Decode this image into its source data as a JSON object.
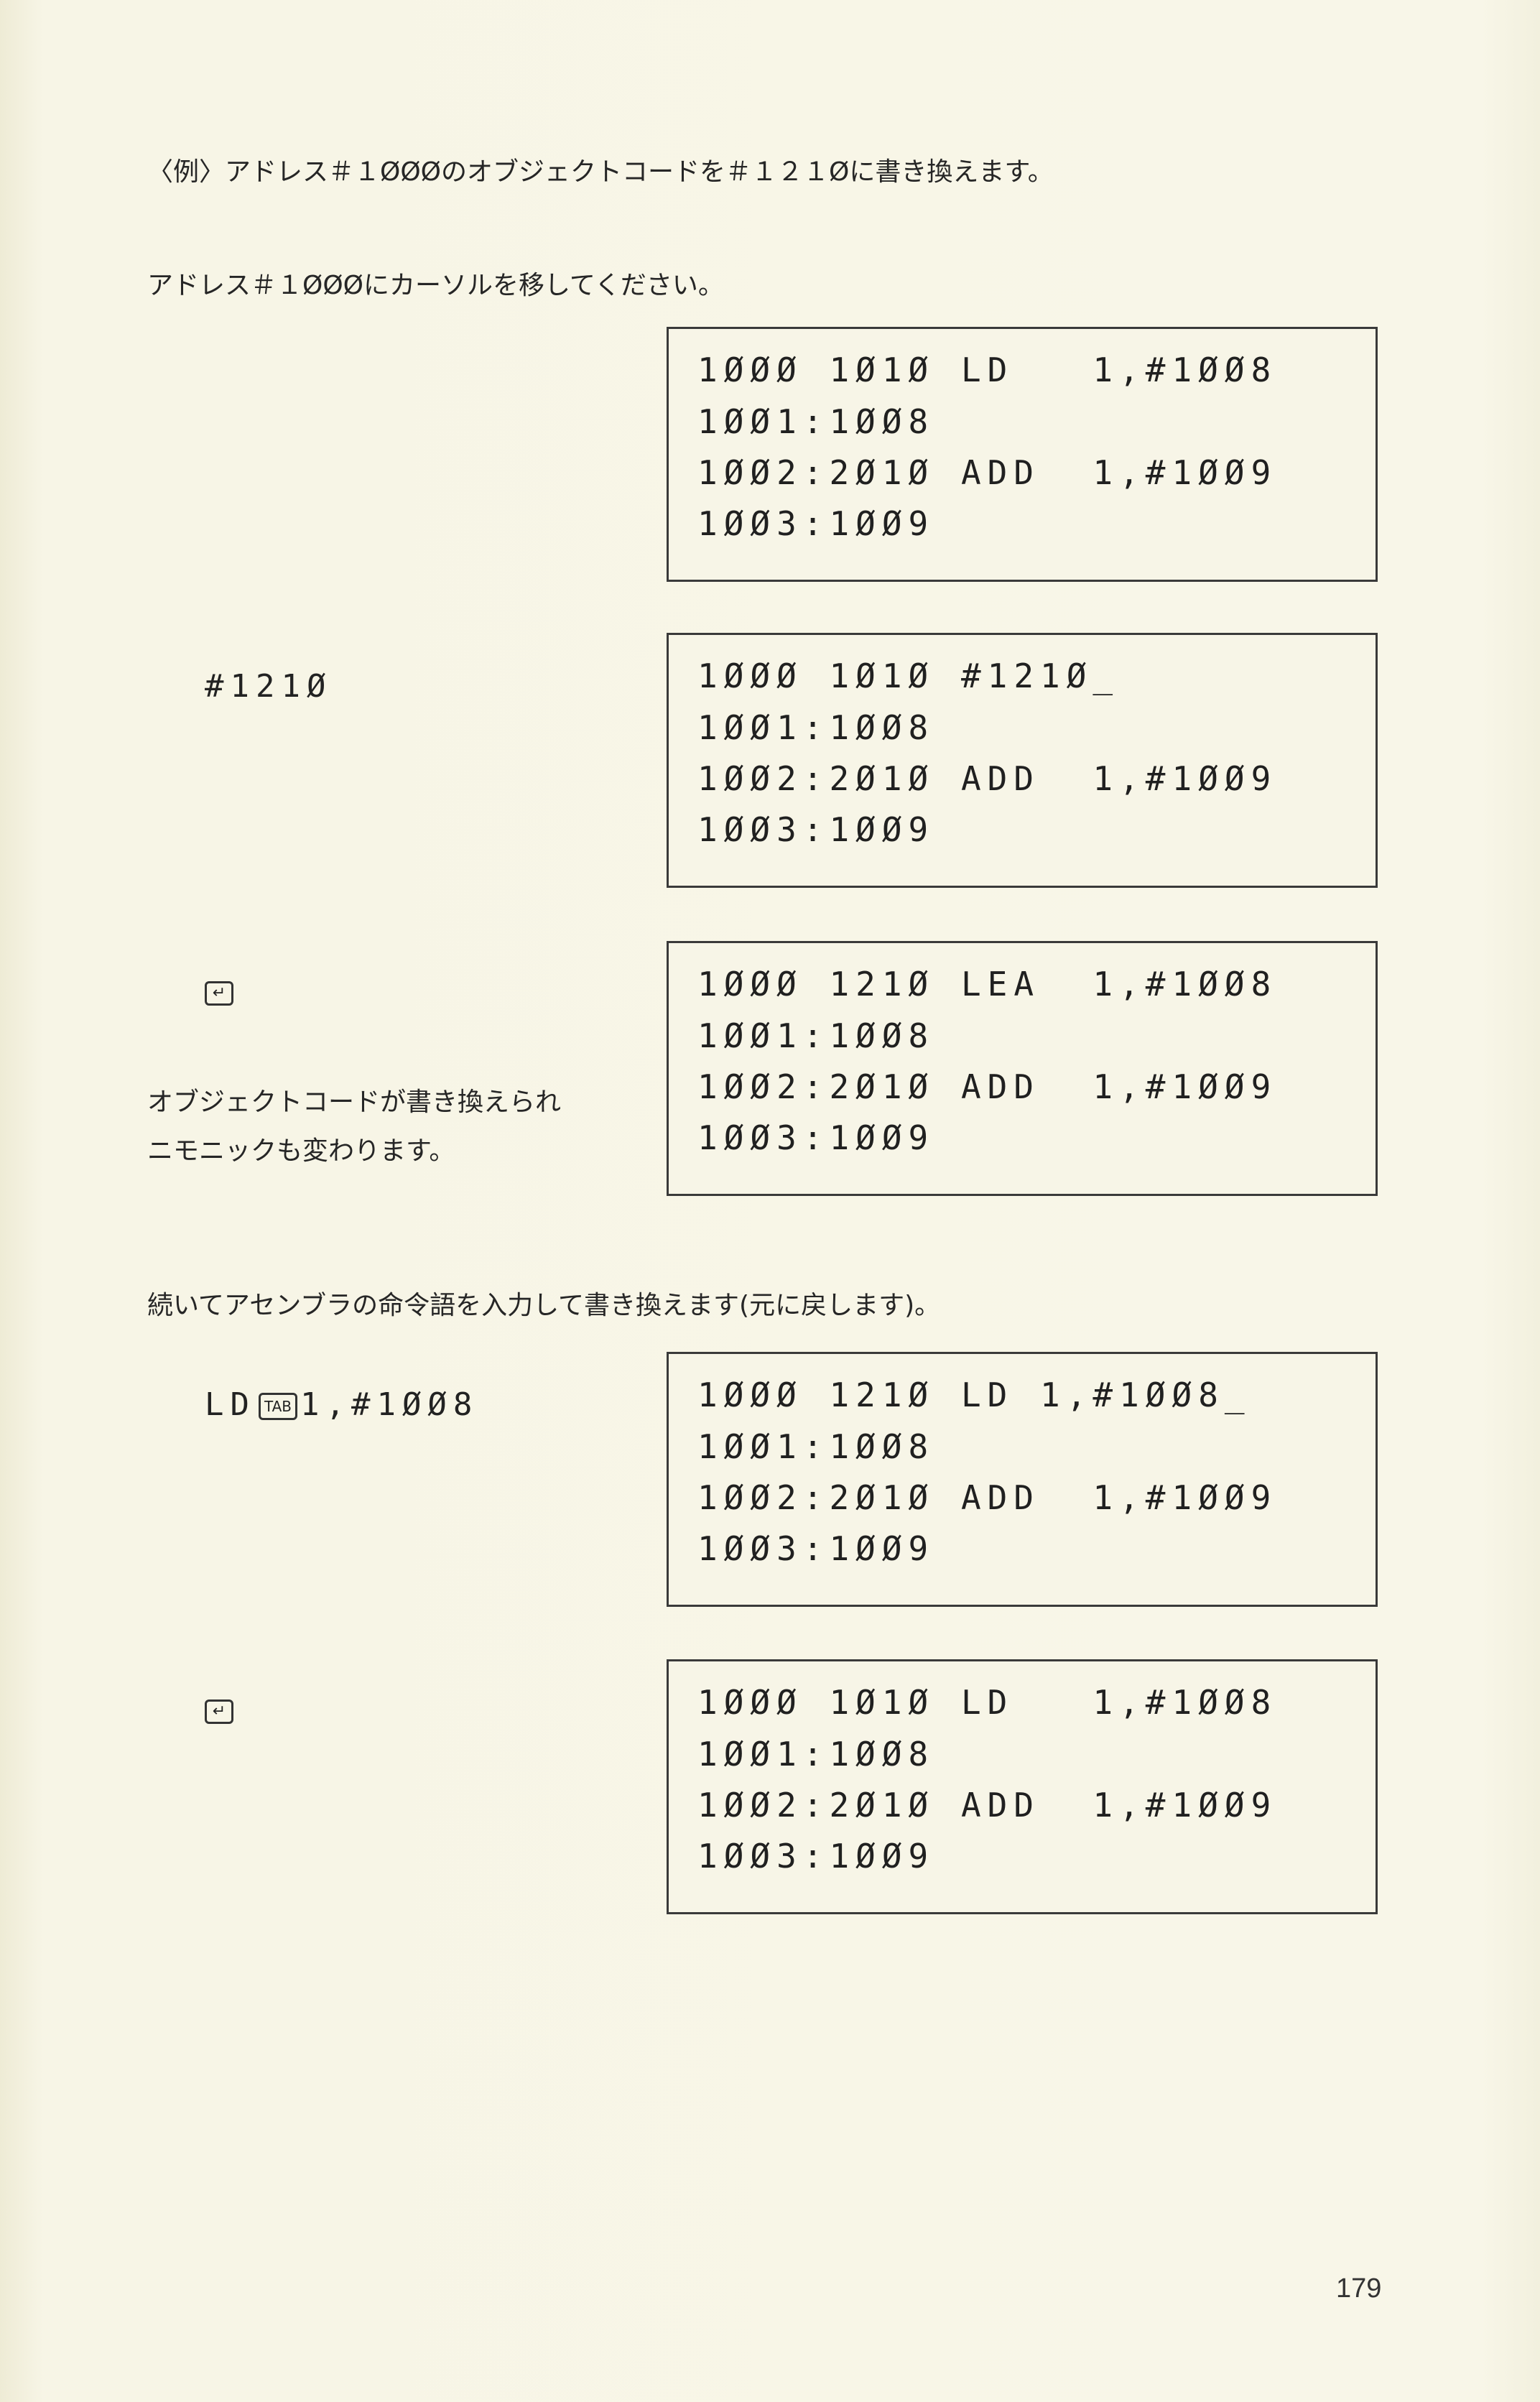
{
  "heading": "〈例〉アドレス＃１ØØØのオブジェクトコードを＃１２１Øに書き換えます。",
  "instruction_1": "アドレス＃１ØØØにカーソルを移してください。",
  "steps": [
    {
      "input": "",
      "key": "",
      "note": [],
      "screen": [
        "1ØØØ 1Ø1Ø LD   1,#1ØØ8",
        "1ØØ1:1ØØ8",
        "1ØØ2:2Ø1Ø ADD  1,#1ØØ9",
        "1ØØ3:1ØØ9"
      ]
    },
    {
      "input": "#121Ø",
      "key": "",
      "note": [],
      "screen": [
        "1ØØØ 1Ø1Ø #121Ø_",
        "1ØØ1:1ØØ8",
        "1ØØ2:2Ø1Ø ADD  1,#1ØØ9",
        "1ØØ3:1ØØ9"
      ]
    },
    {
      "input": "",
      "key": "↵",
      "note": [
        "オブジェクトコードが書き換えられ",
        "ニモニックも変わります。"
      ],
      "screen": [
        "1ØØØ 121Ø LEA  1,#1ØØ8",
        "1ØØ1:1ØØ8",
        "1ØØ2:2Ø1Ø ADD  1,#1ØØ9",
        "1ØØ3:1ØØ9"
      ]
    },
    {
      "input_prefix": "LD",
      "input_key": "TAB",
      "input_suffix": "1,#1ØØ8",
      "screen": [
        "1ØØØ 121Ø LD 1,#1ØØ8_",
        "1ØØ1:1ØØ8",
        "1ØØ2:2Ø1Ø ADD  1,#1ØØ9",
        "1ØØ3:1ØØ9"
      ]
    },
    {
      "input": "",
      "key": "↵",
      "note": [],
      "screen": [
        "1ØØØ 1Ø1Ø LD   1,#1ØØ8",
        "1ØØ1:1ØØ8",
        "1ØØ2:2Ø1Ø ADD  1,#1ØØ9",
        "1ØØ3:1ØØ9"
      ]
    }
  ],
  "instruction_2": "続いてアセンブラの命令語を入力して書き換えます(元に戻します)。",
  "page_number": "179"
}
